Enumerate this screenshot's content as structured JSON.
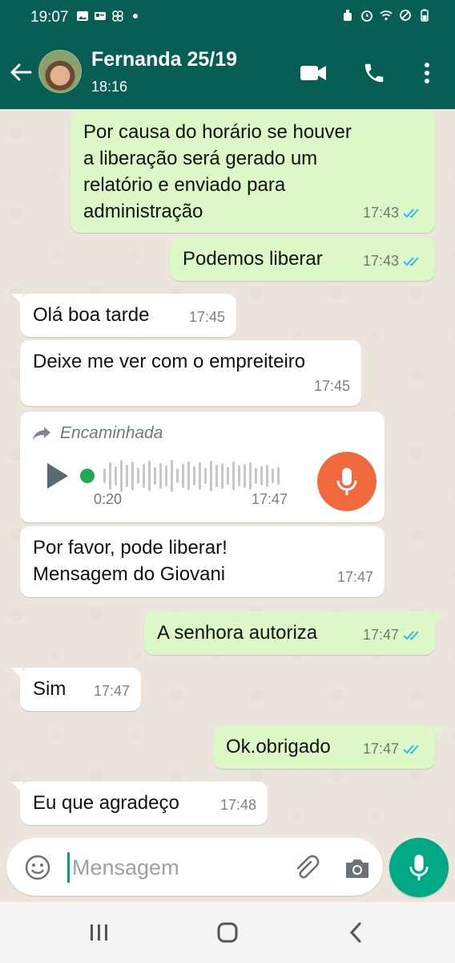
{
  "status_bar": {
    "time": "19:07",
    "left_icons": [
      "image-icon",
      "id-card-icon",
      "pinwheel-icon",
      "dot-icon"
    ],
    "right_icons": [
      "alarm-icon",
      "clock-icon",
      "wifi-icon",
      "dnd-icon",
      "battery-icon"
    ]
  },
  "header": {
    "contact_name": "Fernanda 25/19",
    "subtitle": "18:16",
    "icons": [
      "back-arrow-icon",
      "video-call-icon",
      "phone-icon",
      "more-vert-icon"
    ]
  },
  "messages": [
    {
      "dir": "out",
      "lines": [
        "Por causa  do horário  se houver",
        "a liberação  será gerado  um",
        "relatório  e enviado  para",
        "administração"
      ],
      "time": "17:43",
      "read": true
    },
    {
      "dir": "out",
      "lines": [
        "Podemos liberar"
      ],
      "time": "17:43",
      "read": true
    },
    {
      "dir": "in",
      "lines": [
        "Olá boa tarde"
      ],
      "time": "17:45"
    },
    {
      "dir": "in",
      "lines": [
        "Deixe me ver com o empreiteiro"
      ],
      "time": "17:45"
    },
    {
      "dir": "in",
      "type": "voice",
      "forwarded_label": "Encaminhada",
      "duration": "0:20",
      "time": "17:47"
    },
    {
      "dir": "in",
      "lines": [
        "Por favor, pode liberar!",
        "Mensagem do Giovani"
      ],
      "time": "17:47"
    },
    {
      "dir": "out",
      "lines": [
        "A senhora  autoriza"
      ],
      "time": "17:47",
      "read": true
    },
    {
      "dir": "in",
      "lines": [
        "Sim"
      ],
      "time": "17:47"
    },
    {
      "dir": "out",
      "lines": [
        "Ok.obrigado"
      ],
      "time": "17:47",
      "read": true
    },
    {
      "dir": "in",
      "lines": [
        "Eu que agradeço"
      ],
      "time": "17:48"
    }
  ],
  "input": {
    "placeholder": "Mensagem",
    "icons": [
      "emoji-icon",
      "attach-icon",
      "camera-icon",
      "mic-icon"
    ]
  },
  "colors": {
    "header": "#075e54",
    "outgoing_bubble": "#dcf8c6",
    "incoming_bubble": "#ffffff",
    "read_tick": "#34b7f1",
    "send_button": "#00a884",
    "voice_mic": "#f06a3e"
  }
}
